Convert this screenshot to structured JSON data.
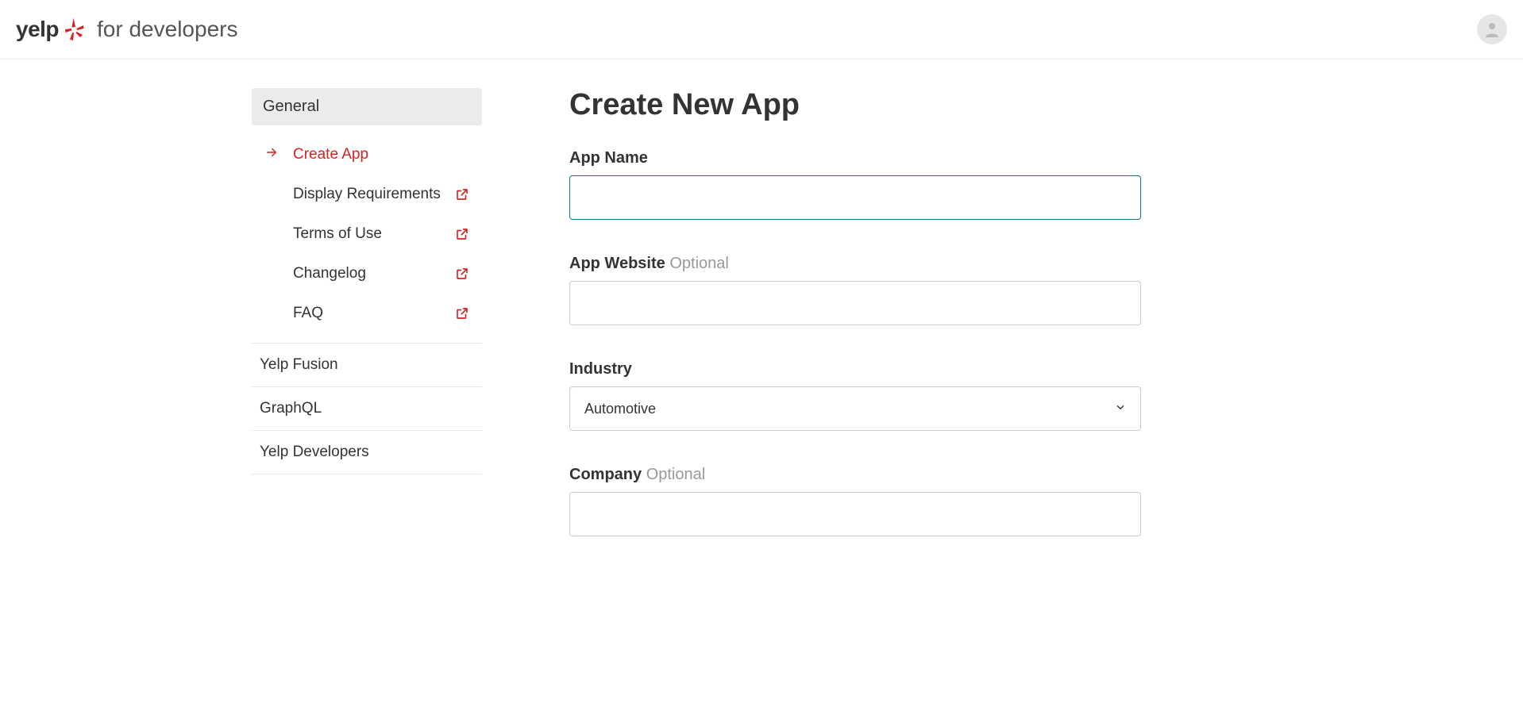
{
  "header": {
    "brand_text": "yelp",
    "for_developers": "for developers"
  },
  "sidebar": {
    "header": "General",
    "items": [
      {
        "label": "Create App",
        "active": true,
        "external": false
      },
      {
        "label": "Display Requirements",
        "active": false,
        "external": true
      },
      {
        "label": "Terms of Use",
        "active": false,
        "external": true
      },
      {
        "label": "Changelog",
        "active": false,
        "external": true
      },
      {
        "label": "FAQ",
        "active": false,
        "external": true
      }
    ],
    "sections": [
      {
        "label": "Yelp Fusion"
      },
      {
        "label": "GraphQL"
      },
      {
        "label": "Yelp Developers"
      }
    ]
  },
  "main": {
    "title": "Create New App",
    "form": {
      "app_name": {
        "label": "App Name",
        "value": ""
      },
      "app_website": {
        "label": "App Website",
        "optional": "Optional",
        "value": ""
      },
      "industry": {
        "label": "Industry",
        "selected": "Automotive"
      },
      "company": {
        "label": "Company",
        "optional": "Optional",
        "value": ""
      }
    }
  }
}
